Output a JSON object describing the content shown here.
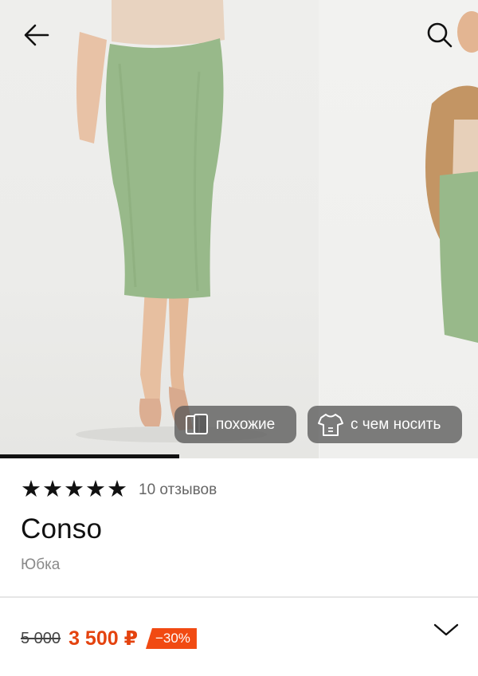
{
  "gallery": {
    "progress_fraction": 0.375,
    "chips": {
      "similar_label": "похожие",
      "outfit_label": "с чем носить"
    }
  },
  "product": {
    "rating_stars": 5,
    "reviews_label": "10 отзывов",
    "brand": "Conso",
    "category": "Юбка",
    "old_price": "5 000",
    "new_price": "3 500 ₽",
    "discount": "−30%"
  },
  "icons": {
    "back": "arrow-left-icon",
    "search": "search-icon",
    "similar": "similar-cards-icon",
    "outfit": "outfit-shirt-icon",
    "expand": "chevron-down-icon"
  },
  "colors": {
    "price": "#e4430f",
    "discount_badge": "#f14a12",
    "chip_bg": "#5a5a5a",
    "skirt": "#98b98a"
  }
}
